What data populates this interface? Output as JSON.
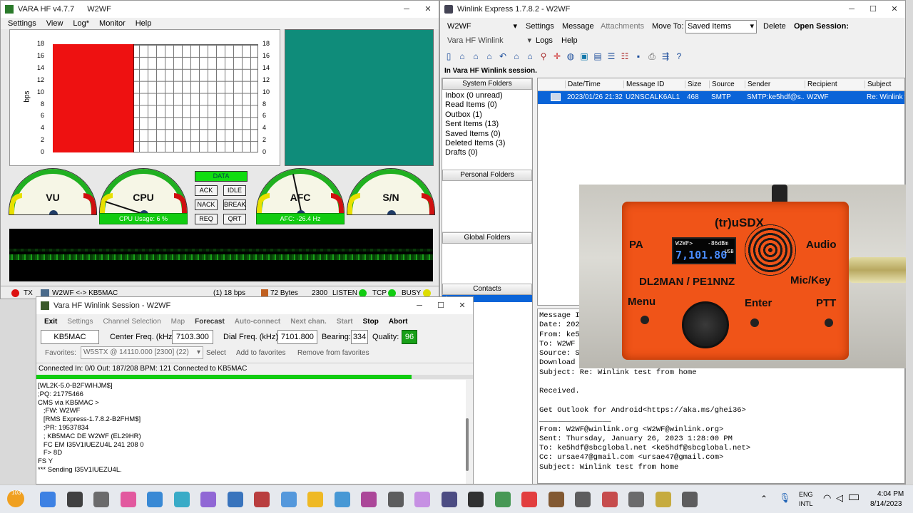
{
  "vara": {
    "title": "VARA HF v4.7.7",
    "callsign": "W2WF",
    "menu": [
      "Settings",
      "View",
      "Log*",
      "Monitor",
      "Help"
    ],
    "yticks": [
      "18",
      "16",
      "14",
      "12",
      "10",
      "8",
      "6",
      "4",
      "2",
      "0"
    ],
    "ylabel": "bps",
    "gauges": {
      "vu": "VU",
      "cpu": "CPU",
      "afc": "AFC",
      "sn": "S/N"
    },
    "cpu_usage": "CPU Usage: 6 %",
    "afc_value": "AFC: -26.4 Hz",
    "status_buttons": {
      "data": "DATA",
      "ack": "ACK",
      "idle": "IDLE",
      "nack": "NACK",
      "break": "BREAK",
      "req": "REQ",
      "qrt": "QRT"
    },
    "statusbar": {
      "tx": "TX",
      "link": "W2WF <-> KB5MAC",
      "rate": "(1)  18 bps",
      "bytes": "72 Bytes",
      "bw": "2300",
      "listen": "LISTEN",
      "tcp": "TCP",
      "busy": "BUSY"
    }
  },
  "session": {
    "title": "Vara HF Winlink Session - W2WF",
    "menu": {
      "exit": "Exit",
      "settings": "Settings",
      "channel": "Channel Selection",
      "map": "Map",
      "forecast": "Forecast",
      "auto": "Auto-connect",
      "next": "Next chan.",
      "start": "Start",
      "stop": "Stop",
      "abort": "Abort"
    },
    "station": "KB5MAC",
    "center_label": "Center Freq. (kHz):",
    "center": "7103.300",
    "dial_label": "Dial Freq. (kHz):",
    "dial": "7101.800",
    "bearing_label": "Bearing:",
    "bearing": "334",
    "quality_label": "Quality:",
    "quality": "96",
    "favorites_label": "Favorites:",
    "favorite": "W5STX  @  14110.000 [2300]  (22)",
    "select": "Select",
    "add_fav": "Add to favorites",
    "remove_fav": "Remove from favorites",
    "status": "Connected   In: 0/0   Out: 187/208   BPM: 121   Connected to KB5MAC",
    "progress": 0.86,
    "log": [
      "[WL2K-5.0-B2FWIHJM$]",
      ";PQ: 21775466",
      "CMS via KB5MAC >",
      "   ;FW: W2WF",
      "   [RMS Express-1.7.8.2-B2FHM$]",
      "   ;PR: 19537834",
      "   ; KB5MAC DE W2WF (EL29HR)",
      "   FC EM I35V1IUEZU4L 241 208 0",
      "   F> 8D",
      "FS Y",
      "*** Sending I35V1IUEZU4L."
    ]
  },
  "winlink": {
    "title": "Winlink Express 1.7.8.2 - W2WF",
    "callsign": "W2WF",
    "mode": "Vara HF Winlink",
    "menu": {
      "settings": "Settings",
      "message": "Message",
      "attachments": "Attachments",
      "moveto": "Move To:",
      "logs": "Logs",
      "help": "Help",
      "delete": "Delete",
      "open": "Open Session:"
    },
    "moveto_value": "Saved Items",
    "session_text": "In Vara HF Winlink session.",
    "system_folders": "System Folders",
    "folders": [
      "Inbox  (0 unread)",
      "Read Items  (0)",
      "Outbox  (1)",
      "Sent Items  (13)",
      "Saved Items  (0)",
      "Deleted Items  (3)",
      "Drafts  (0)"
    ],
    "personal_folders": "Personal Folders",
    "global_folders": "Global Folders",
    "contacts": "Contacts",
    "contact_a": "A",
    "columns": [
      "Date/Time",
      "Message ID",
      "Size",
      "Source",
      "Sender",
      "Recipient",
      "Subject"
    ],
    "row": [
      "2023/01/26 21:32",
      "U2NSCALK6AL1",
      "468",
      "SMTP",
      "SMTP:ke5hdf@s...",
      "W2WF",
      "Re: Winlink te"
    ],
    "preview": [
      "Message I",
      "Date: 202",
      "From: ke5",
      "To: W2WF",
      "Source: S",
      "Download",
      "Subject: Re: Winlink test from home",
      "",
      "Received.",
      "",
      "Get Outlook for Android<https://aka.ms/ghei36>",
      "________________",
      "From: W2WF@winlink.org <W2WF@winlink.org>",
      "Sent: Thursday, January 26, 2023 1:28:00 PM",
      "To: ke5hdf@sbcglobal.net <ke5hdf@sbcglobal.net>",
      "Cc: ursae47@gmail.com <ursae47@gmail.com>",
      "Subject: Winlink test from home"
    ]
  },
  "radio": {
    "title": "(tr)uSDX",
    "pa": "PA",
    "audio": "Audio",
    "call": "DL2MAN / PE1NNZ",
    "mic": "Mic/Key",
    "menu": "Menu",
    "enter": "Enter",
    "ptt": "PTT",
    "oled_call": "W2WF>",
    "oled_db": "-86dBm",
    "oled_freq": "7,101.80",
    "oled_mode": "USB"
  },
  "taskbar": {
    "temp": "103°",
    "lang1": "ENG",
    "lang2": "INTL",
    "time": "4:04 PM",
    "date": "8/14/2023"
  },
  "colors": {
    "bar": "#ee1111",
    "teal": "#0f8c7a",
    "select": "#0a64d8",
    "green": "#11cc11"
  }
}
